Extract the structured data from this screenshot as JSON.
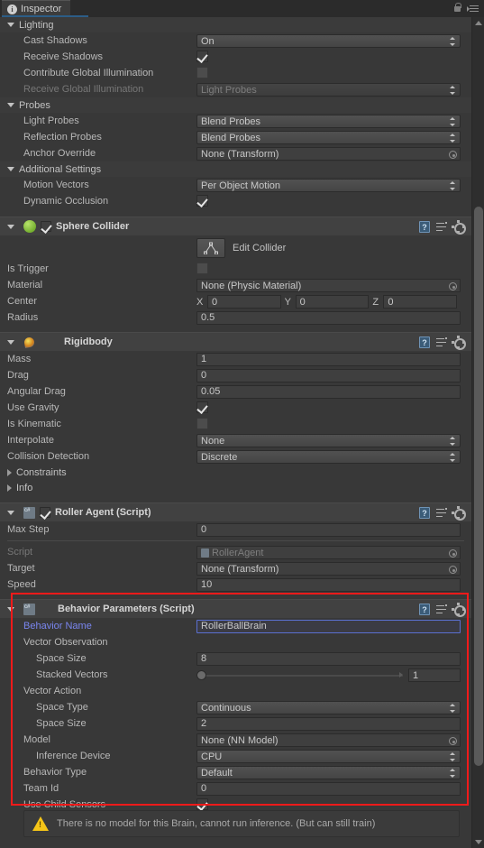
{
  "window": {
    "tab_label": "Inspector",
    "info_glyph": "i",
    "lock_icon": "lock-icon",
    "menu_icon": "menu-icon"
  },
  "colors": {
    "accent_red": "#f21a1a",
    "override_blue": "#7a86f0",
    "warning_yellow": "#f5c518",
    "panel_bg": "#383838",
    "header_bg": "#414141"
  },
  "renderer_sections": [
    {
      "name": "Lighting",
      "expanded": true,
      "rows": [
        {
          "label": "Cast Shadows",
          "type": "dropdown",
          "value": "On",
          "dim": false
        },
        {
          "label": "Receive Shadows",
          "type": "checkbox",
          "value": "checked",
          "dim": false
        },
        {
          "label": "Contribute Global Illumination",
          "type": "checkbox",
          "value": "unchecked",
          "dim": false
        },
        {
          "label": "Receive Global Illumination",
          "type": "dropdown",
          "value": "Light Probes",
          "dim": true
        }
      ]
    },
    {
      "name": "Probes",
      "expanded": true,
      "rows": [
        {
          "label": "Light Probes",
          "type": "dropdown",
          "value": "Blend Probes",
          "dim": false
        },
        {
          "label": "Reflection Probes",
          "type": "dropdown",
          "value": "Blend Probes",
          "dim": false
        },
        {
          "label": "Anchor Override",
          "type": "objectfield",
          "value": "None (Transform)",
          "dim": false
        }
      ]
    },
    {
      "name": "Additional Settings",
      "expanded": true,
      "rows": [
        {
          "label": "Motion Vectors",
          "type": "dropdown",
          "value": "Per Object Motion",
          "dim": false
        },
        {
          "label": "Dynamic Occlusion",
          "type": "checkbox",
          "value": "checked",
          "dim": false
        }
      ]
    }
  ],
  "sphere_collider": {
    "title": "Sphere Collider",
    "enabled": true,
    "icon": "sphere-collider-icon",
    "edit_collider_label": "Edit Collider",
    "rows": [
      {
        "label": "Is Trigger",
        "type": "checkbox",
        "value": "unchecked"
      },
      {
        "label": "Material",
        "type": "objectfield",
        "value": "None (Physic Material)"
      },
      {
        "label": "Center",
        "type": "vector3",
        "x": "0",
        "y": "0",
        "z": "0",
        "ax": "X",
        "ay": "Y",
        "az": "Z"
      },
      {
        "label": "Radius",
        "type": "text",
        "value": "0.5"
      }
    ]
  },
  "rigidbody": {
    "title": "Rigidbody",
    "icon": "rigidbody-icon",
    "rows": [
      {
        "label": "Mass",
        "type": "text",
        "value": "1"
      },
      {
        "label": "Drag",
        "type": "text",
        "value": "0"
      },
      {
        "label": "Angular Drag",
        "type": "text",
        "value": "0.05"
      },
      {
        "label": "Use Gravity",
        "type": "checkbox",
        "value": "checked"
      },
      {
        "label": "Is Kinematic",
        "type": "checkbox",
        "value": "unchecked"
      },
      {
        "label": "Interpolate",
        "type": "dropdown",
        "value": "None"
      },
      {
        "label": "Collision Detection",
        "type": "dropdown",
        "value": "Discrete"
      }
    ],
    "foldouts": [
      {
        "label": "Constraints",
        "expanded": false
      },
      {
        "label": "Info",
        "expanded": false
      }
    ]
  },
  "roller_agent": {
    "title": "Roller Agent (Script)",
    "enabled": true,
    "icon": "script-icon",
    "rows_top": [
      {
        "label": "Max Step",
        "type": "text",
        "value": "0"
      }
    ],
    "rows_bottom": [
      {
        "label": "Script",
        "type": "objectfield",
        "value": "RollerAgent",
        "dim": true
      },
      {
        "label": "Target",
        "type": "objectfield",
        "value": "None (Transform)",
        "dim": false
      },
      {
        "label": "Speed",
        "type": "text",
        "value": "10"
      }
    ]
  },
  "behavior_parameters": {
    "title": "Behavior Parameters (Script)",
    "icon": "script-icon",
    "highlighted": true,
    "behavior_name": {
      "label": "Behavior Name",
      "value": "RollerBallBrain"
    },
    "vector_observation": {
      "label": "Vector Observation",
      "space_size": {
        "label": "Space Size",
        "value": "8"
      },
      "stacked_vectors": {
        "label": "Stacked Vectors",
        "value": "1"
      }
    },
    "vector_action": {
      "label": "Vector Action",
      "space_type": {
        "label": "Space Type",
        "value": "Continuous"
      },
      "space_size": {
        "label": "Space Size",
        "value": "2"
      }
    },
    "model": {
      "label": "Model",
      "value": "None (NN Model)"
    },
    "inference_device": {
      "label": "Inference Device",
      "value": "CPU"
    },
    "behavior_type": {
      "label": "Behavior Type",
      "value": "Default"
    },
    "team_id": {
      "label": "Team Id",
      "value": "0"
    },
    "use_child_sensors": {
      "label": "Use Child Sensors",
      "value": "checked"
    }
  },
  "warning": {
    "icon": "warning-icon",
    "message": "There is no model for this Brain, cannot run inference. (But can still train)"
  }
}
